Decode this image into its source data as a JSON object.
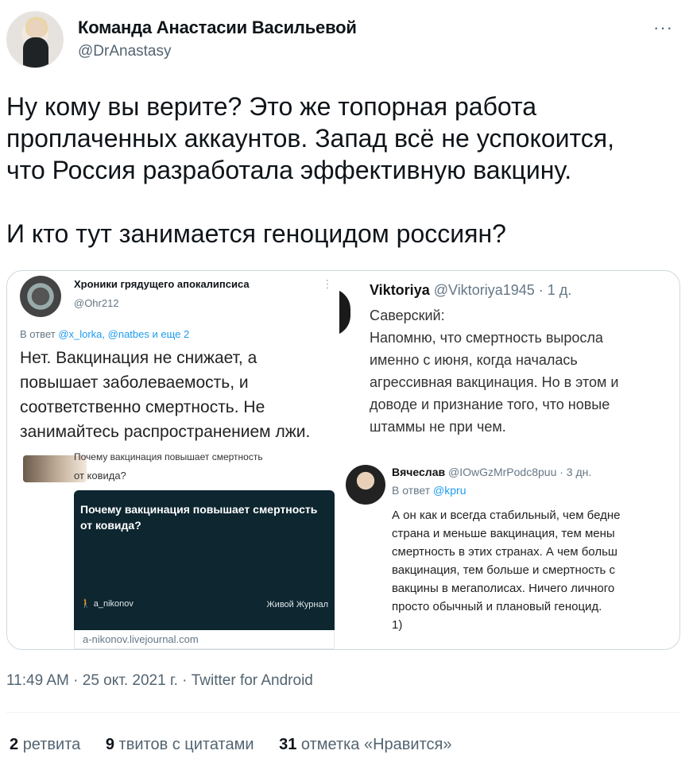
{
  "author": {
    "name": "Команда Анастасии Васильевой",
    "handle": "@DrAnastasy",
    "more": "···"
  },
  "tweet": {
    "lines": [
      "Ну кому вы верите? Это же топорная работа",
      "проплаченных аккаунтов. Запад всё не успокоится,",
      "что Россия разработала эффективную вакцину.",
      "И кто тут занимается геноцидом россиян?"
    ]
  },
  "media": {
    "left": {
      "name": "Хроники грядущего апокалипсиса",
      "handle": "@Ohr212",
      "dots": "⋮",
      "reply_prefix": "В ответ ",
      "reply_links": "@x_lorka, @natbes и еще 2",
      "text": "Нет. Вакцинация не снижает, а повышает заболеваемость, и соответственно смертность. Не занимайтесь распространением лжи.",
      "sub_line": "Почему вакцинация повышает смертность",
      "sub_line2": "от ковида?",
      "card": {
        "title": "Почему вакцинация повышает смертность от ковида?",
        "user": "🚶 a_nikonov",
        "source": "Живой Журнал",
        "url": "a-nikonov.livejournal.com"
      }
    },
    "right": {
      "name": "Viktoriya",
      "handle": "@Viktoriya1945 · 1 д.",
      "lines": [
        "Саверский:",
        "Напомню, что смертность выросла",
        "именно с июня, когда началась",
        "агрессивная вакцинация. Но в этом и",
        "доводе и признание того, что новые",
        "штаммы не при чем."
      ],
      "reply": {
        "name": "Вячеслав",
        "handle": "@IOwGzMrPodc8puu · 3 дн.",
        "reply_prefix": "В ответ ",
        "reply_link": "@kpru",
        "lines": [
          "А он как и всегда стабильный, чем бедне",
          "страна и меньше вакцинация, тем мены",
          "смертность в этих странах. А чем больш",
          "вакцинация, тем больше и смертность с",
          "вакцины в мегаполисах. Ничего личного",
          "просто обычный и плановый геноцид.",
          "1)"
        ]
      }
    }
  },
  "timestamp": "11:49 AM · 25 окт. 2021 г. · Twitter for Android",
  "stats": {
    "retweets_count": "2",
    "retweets_label": "ретвита",
    "quotes_count": "9",
    "quotes_label": "твитов с цитатами",
    "likes_count": "31",
    "likes_label": "отметка «Нравится»"
  }
}
